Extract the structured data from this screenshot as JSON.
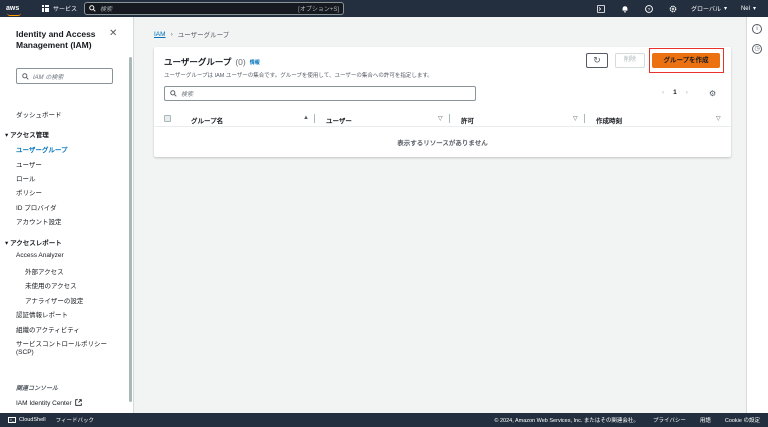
{
  "topnav": {
    "logo": "aws",
    "services": "サービス",
    "search_placeholder": "検索",
    "search_shortcut": "[オプション+S]",
    "region": "グローバル",
    "user": "Nel"
  },
  "sidenav": {
    "title": "Identity and Access Management (IAM)",
    "search_placeholder": "IAM の検索",
    "dashboard": "ダッシュボード",
    "access_mgmt": "アクセス管理",
    "user_groups": "ユーザーグループ",
    "users": "ユーザー",
    "roles": "ロール",
    "policies": "ポリシー",
    "id_providers": "ID プロバイダ",
    "account_settings": "アカウント設定",
    "access_reports": "アクセスレポート",
    "access_analyzer": "Access Analyzer",
    "external_access": "外部アクセス",
    "unused_access": "未使用のアクセス",
    "analyzer_settings": "アナライザーの設定",
    "cred_report": "認証情報レポート",
    "org_activity": "組織のアクティビティ",
    "scp_line1": "サービスコントロールポリシー",
    "scp_line2": "(SCP)",
    "related_console": "関連コンソール",
    "identity_center": "IAM Identity Center"
  },
  "breadcrumb": {
    "root": "IAM",
    "current": "ユーザーグループ"
  },
  "panel": {
    "title": "ユーザーグループ",
    "count": "(0)",
    "info": "情報",
    "description": "ユーザーグループは IAM ユーザーの集合です。グループを使用して、ユーザーの集合への許可を指定します。",
    "delete": "削除",
    "create": "グループを作成",
    "search_placeholder": "検索",
    "page": "1",
    "columns": [
      "グループ名",
      "ユーザー",
      "許可",
      "作成時刻"
    ],
    "empty": "表示するリソースがありません"
  },
  "footer": {
    "cloudshell": "CloudShell",
    "feedback": "フィードバック",
    "copyright": "© 2024, Amazon Web Services, Inc. またはその関連会社。",
    "privacy": "プライバシー",
    "terms": "用語",
    "cookie": "Cookie の設定"
  }
}
